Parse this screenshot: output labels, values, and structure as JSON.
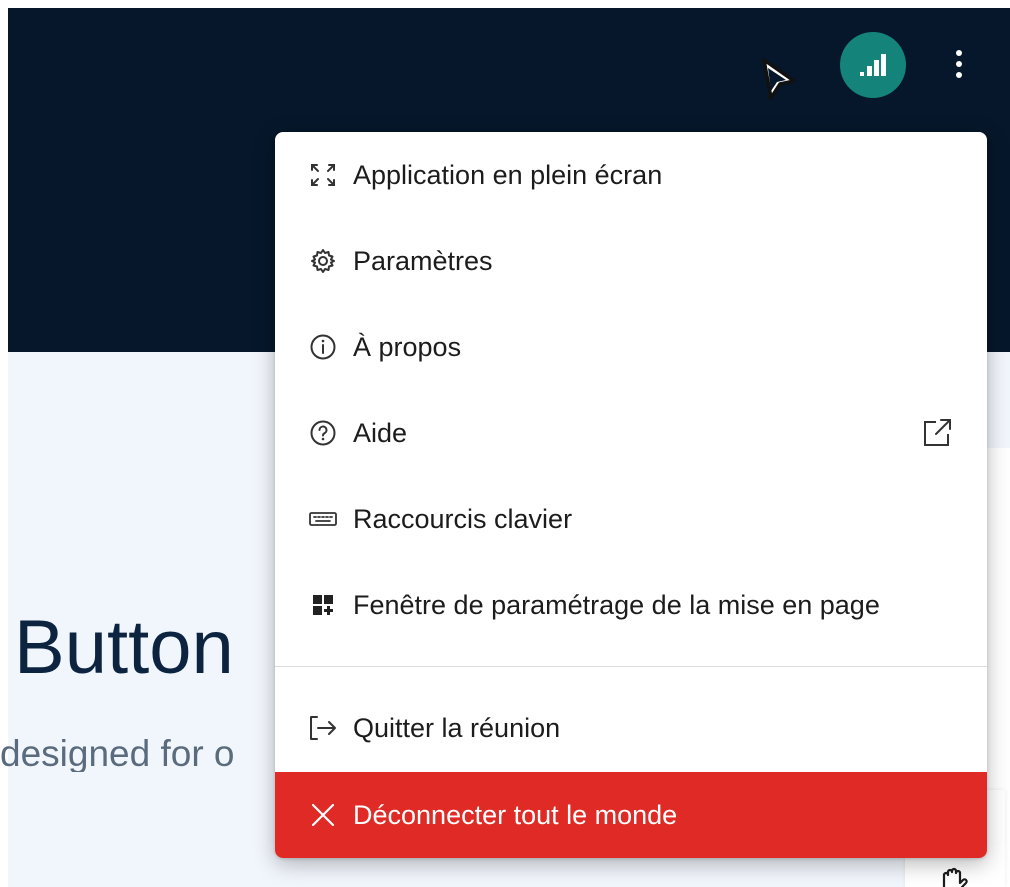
{
  "page": {
    "hero_title": "Button",
    "hero_subtitle": "designed for o"
  },
  "header": {
    "avatar_icon": "signal-bars-icon",
    "avatar_color": "#14847a",
    "more_icon": "vertical-dots-icon"
  },
  "menu": {
    "items": [
      {
        "label": "Application en plein écran",
        "icon": "fullscreen-icon"
      },
      {
        "label": "Paramètres",
        "icon": "gear-icon"
      },
      {
        "label": "À propos",
        "icon": "info-icon"
      },
      {
        "label": "Aide",
        "icon": "help-icon",
        "trailing_icon": "external-link-icon"
      },
      {
        "label": "Raccourcis clavier",
        "icon": "keyboard-icon"
      },
      {
        "label": "Fenêtre de paramétrage de la mise en page",
        "icon": "layout-icon"
      },
      {
        "label": "Quitter la réunion",
        "icon": "leave-icon"
      },
      {
        "label": "Déconnecter tout le monde",
        "icon": "close-icon",
        "variant": "danger",
        "color": "#e02a25"
      }
    ]
  },
  "colors": {
    "topbar_background": "#06172b",
    "content_background": "#f1f6fc",
    "danger": "#e02a25"
  }
}
